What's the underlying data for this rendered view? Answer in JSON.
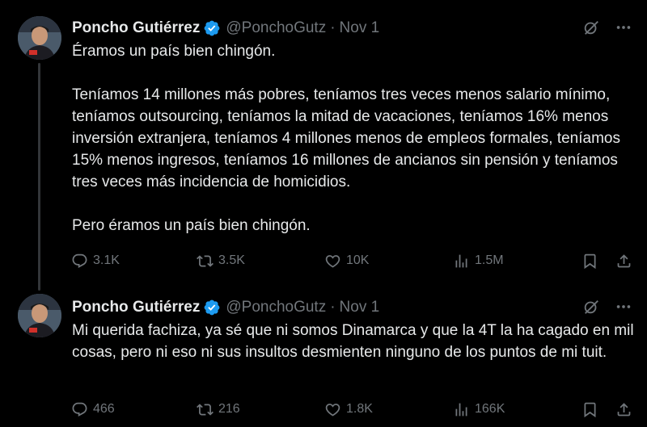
{
  "tweets": [
    {
      "display_name": "Poncho Gutiérrez",
      "handle": "@PonchoGutz",
      "separator": "·",
      "date": "Nov 1",
      "paragraphs": [
        "Éramos un país bien chingón.",
        "Teníamos 14 millones más pobres, teníamos tres veces menos salario mínimo, teníamos outsourcing, teníamos la mitad de vacaciones, teníamos 16% menos inversión extranjera, teníamos 4 millones menos de empleos formales, teníamos 15% menos ingresos, teníamos 16 millones de ancianos sin pensión y teníamos tres veces más incidencia de homicidios.",
        "Pero éramos un país bien chingón."
      ],
      "stats": {
        "replies": "3.1K",
        "reposts": "3.5K",
        "likes": "10K",
        "views": "1.5M"
      }
    },
    {
      "display_name": "Poncho Gutiérrez",
      "handle": "@PonchoGutz",
      "separator": "·",
      "date": "Nov 1",
      "paragraphs": [
        "Mi querida fachiza, ya sé que ni somos Dinamarca y que la 4T la ha cagado en mil cosas, pero ni eso ni sus insultos desmienten ninguno de los puntos de mi tuit."
      ],
      "stats": {
        "replies": "466",
        "reposts": "216",
        "likes": "1.8K",
        "views": "166K"
      }
    }
  ],
  "icons": {
    "verified": "verified-badge-icon",
    "grok": "grok-icon",
    "more": "more-icon",
    "reply": "reply-icon",
    "repost": "repost-icon",
    "like": "like-icon",
    "views": "views-icon",
    "bookmark": "bookmark-icon",
    "share": "share-icon"
  },
  "colors": {
    "background": "#000000",
    "text": "#e7e9ea",
    "secondary": "#71767b",
    "verified": "#1d9bf0",
    "thread_line": "#333639"
  }
}
